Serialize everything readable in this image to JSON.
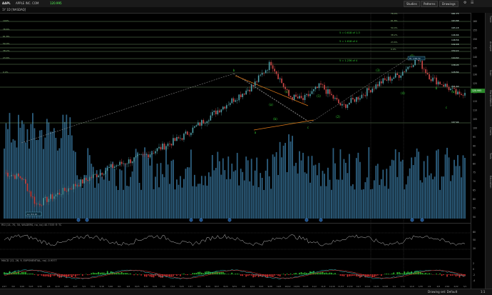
{
  "window": {
    "symbol": "AAPL",
    "company": "APPLE INC. COM",
    "last_price": "120.995",
    "toolbar": {
      "studies": "Studies",
      "patterns": "Patterns",
      "drawings": "Drawings"
    },
    "aggregation": "1Y 1D [NASDAQ]"
  },
  "colors": {
    "background": "#000000",
    "volume": "#2d5f7f",
    "fib_lines": "#8fbf7f",
    "wave_labels": "#33cc33",
    "wedge": "#e07b1a",
    "candle_up": "#4fa0a8",
    "candle_down": "#d04848"
  },
  "price_axis": {
    "ticks": [
      "160",
      "155",
      "150",
      "145",
      "140",
      "135",
      "130",
      "125",
      "120",
      "115",
      "110",
      "105",
      "100",
      "95",
      "90",
      "85",
      "80",
      "75",
      "70",
      "65",
      "60",
      "55",
      "50"
    ],
    "fib_prices": [
      "161.75",
      "163.88",
      "165.18",
      "146.66",
      "148.56",
      "142.48",
      "150.22",
      "144.60",
      "138.05",
      "128.84",
      "121.60",
      "107.94"
    ]
  },
  "fib_labels_left": [
    "100%",
    "78.6%",
    "61.8%",
    "50.0%",
    "38.2%",
    "23.6%",
    "0.0%"
  ],
  "fib_labels_right": [
    "76.4%",
    "61.8%",
    "50.0%",
    "38.2%",
    "23.6%",
    "0.0%"
  ],
  "projection_labels": [
    "5 = 0.618 of 1-3",
    "5 = 1.618 of 4",
    "5 = 1.236 of 4"
  ],
  "wave_labels": [
    "b",
    "a",
    "c",
    "(a)",
    "(b)",
    "(c)",
    "(1)",
    "(2)",
    "(3)",
    "(4)",
    "(5)",
    "b",
    "c",
    "(a)"
  ],
  "low_label": "Lo: 53.15",
  "high_label": "Hi: 138.79",
  "date_axis": [
    "2/27",
    "3/9",
    "3/16",
    "3/23",
    "3/30",
    "4/6",
    "4/13",
    "4/20",
    "4/27",
    "5/4",
    "5/11",
    "5/18",
    "5/26",
    "6/1",
    "6/8",
    "6/15",
    "6/22",
    "6/29",
    "7/6",
    "7/13",
    "7/20",
    "7/27",
    "8/3",
    "8/10",
    "8/17",
    "8/24",
    "8/31",
    "9/8",
    "9/14",
    "9/21",
    "9/28",
    "10/5",
    "10/12",
    "10/19",
    "10/26",
    "11/2",
    "11/9",
    "11/16",
    "11/23",
    "11/30",
    "12/7",
    "12/14",
    "12/21",
    "12/28",
    "1/4",
    "1/11",
    "1/19",
    "1/25",
    "2/1",
    "2/8",
    "2/16",
    "2/22",
    "3/1"
  ],
  "rsi_pane": {
    "label": "RSI (14, 70, 30, WILDERS, no, no) 40.7333 ® TC",
    "ticks": [
      "80",
      "50",
      "20"
    ]
  },
  "macd_pane": {
    "label": "MACD (12, 26, 9, EXPONENTIAL, no) -0.9377",
    "ticks": [
      "2",
      "0",
      "-2",
      "-4"
    ]
  },
  "bottom": {
    "drawings_set": "Drawing set: Default",
    "zoom": "1:1"
  },
  "right_tabs": [
    "Trade",
    "Analyze",
    "Scan",
    "MarketWatch",
    "Charts",
    "Tools",
    "Education"
  ]
}
